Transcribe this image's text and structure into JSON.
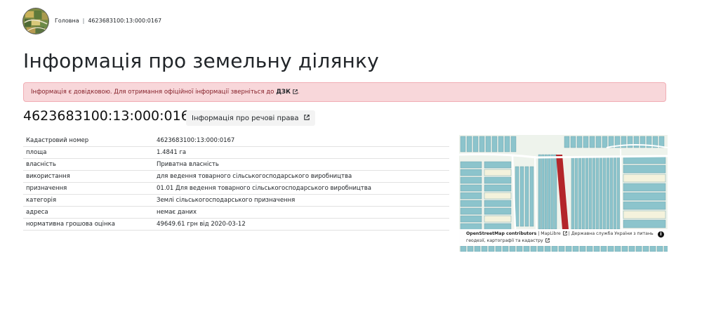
{
  "breadcrumb": {
    "home": "Головна",
    "separator": "|",
    "current": "4623683100:13:000:0167"
  },
  "page_title": "Інформація про земельну ділянку",
  "alert": {
    "text": "Інформація є довідковою. Для отримання офіційної інформації зверніться до",
    "link": "ДЗК",
    "suffix": "."
  },
  "cadastral_number": "4623683100:13:000:0167",
  "rights_button": "Інформація про речові права",
  "table": [
    {
      "key": "Кадастровий номер",
      "value": "4623683100:13:000:0167"
    },
    {
      "key": "площа",
      "value": "1.4841 га"
    },
    {
      "key": "власність",
      "value": "Приватна власність"
    },
    {
      "key": "використання",
      "value": "для ведення товарного сільськогосподарського виробництва"
    },
    {
      "key": "призначення",
      "value": "01.01 Для ведення товарного сільськогосподарського виробництва"
    },
    {
      "key": "категорія",
      "value": "Землі сільськогосподарського призначення"
    },
    {
      "key": "адреса",
      "value": "немає даних"
    },
    {
      "key": "нормативна грошова оцінка",
      "value": "49649.61 грн від 2020-03-12"
    }
  ],
  "map": {
    "attrib_osm": "OpenStreetMap contributors",
    "attrib_sep": "|",
    "attrib_maplibre": "MapLibre",
    "attrib_gov": "Державна служба України з питань геодезії, картографії та кадастру",
    "colors": {
      "parcel": "#8cc4cc",
      "selected": "#b3262a",
      "background": "#eef3ec",
      "road": "#ffffff"
    }
  }
}
